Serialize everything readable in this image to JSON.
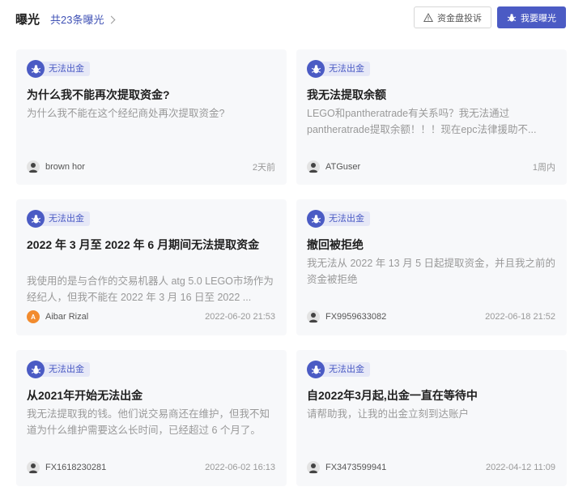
{
  "header": {
    "title": "曝光",
    "count_label": "共23条曝光",
    "complaint_button": "资金盘投诉",
    "expose_button": "我要曝光"
  },
  "colors": {
    "accent": "#4b5bc4",
    "tag_bg": "#e6e8f7",
    "card_bg": "#f7f8fa"
  },
  "cards": [
    {
      "tag": "无法出金",
      "title": "为什么我不能再次提取资金?",
      "desc": "为什么我不能在这个经纪商处再次提取资金?",
      "author": "brown hor",
      "time": "2天前",
      "avatar": "user-icon"
    },
    {
      "tag": "无法出金",
      "title": "我无法提取余额",
      "desc": "LEGO和pantheratrade有关系吗？我无法通过pantheratrade提取余额！！！现在epc法律援助不...",
      "author": "ATGuser",
      "time": "1周内",
      "avatar": "user-icon"
    },
    {
      "tag": "无法出金",
      "title": "2022 年 3 月至 2022 年 6 月期间无法提取资金",
      "desc": "我使用的是与合作的交易机器人 atg 5.0 LEGO市场作为经纪人，但我不能在 2022 年 3 月 16 日至 2022 ...",
      "author": "Aibar Rizal",
      "time": "2022-06-20 21:53",
      "avatar": "A"
    },
    {
      "tag": "无法出金",
      "title": "撤回被拒绝",
      "desc": "我无法从 2022 年 13 月 5 日起提取资金，并且我之前的资金被拒绝",
      "author": "FX9959633082",
      "time": "2022-06-18 21:52",
      "avatar": "user-icon"
    },
    {
      "tag": "无法出金",
      "title": "从2021年开始无法出金",
      "desc": "我无法提取我的钱。他们说交易商还在维护，但我不知道为什么维护需要这么长时间，已经超过 6 个月了。",
      "author": "FX1618230281",
      "time": "2022-06-02 16:13",
      "avatar": "user-icon"
    },
    {
      "tag": "无法出金",
      "title": "自2022年3月起,出金一直在等待中",
      "desc": "请帮助我，让我的出金立刻到达账户",
      "author": "FX3473599941",
      "time": "2022-04-12 11:09",
      "avatar": "user-icon"
    }
  ]
}
